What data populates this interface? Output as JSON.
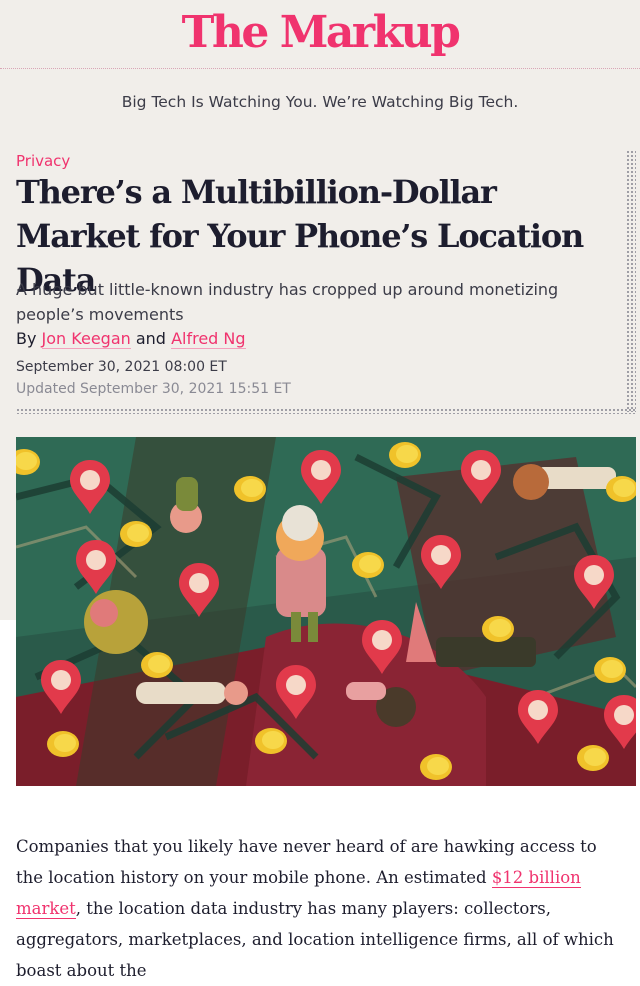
{
  "site": {
    "logo_text": "The Markup",
    "tagline": "Big Tech Is Watching You. We’re Watching Big Tech."
  },
  "article": {
    "category": "Privacy",
    "headline": "There’s a Multibillion-Dollar Market for Your Phone’s Location Data",
    "dek": "A huge but little-known industry has cropped up around monetizing people’s movements",
    "byline": {
      "prefix": "By",
      "author1": "Jon Keegan",
      "conjunction": "and",
      "author2": "Alfred Ng"
    },
    "published": "September 30, 2021 08:00 ET",
    "updated": "Updated September 30, 2021 15:51 ET",
    "body": {
      "part1": "Companies that you likely have never heard of are hawking access to the location history on your mobile phone. An estimated ",
      "link_text": "$12 billion market",
      "part2": ", the location data industry has many players: collectors, aggregators, marketplaces, and location intelligence firms, all of which boast about the"
    }
  },
  "colors": {
    "accent": "#f0336e",
    "header_bg": "#f1eeea",
    "text": "#1e1e2e",
    "muted": "#8a8a94"
  },
  "hero_image": {
    "icon": "illustration-location-pins-coins-people"
  }
}
